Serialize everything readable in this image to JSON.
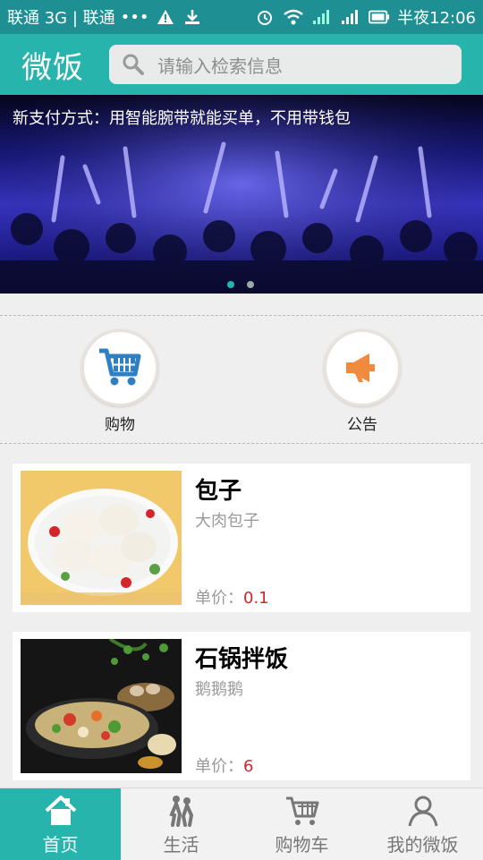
{
  "status_bar": {
    "carrier": "联通 3G | 联通",
    "dots": "•••",
    "time": "半夜12:06",
    "icons": [
      "warning-icon",
      "download-icon",
      "alarm-icon",
      "wifi-icon",
      "signal-icon",
      "signal-icon",
      "battery-icon"
    ]
  },
  "header": {
    "app_name": "微饭",
    "search_placeholder": "请输入检索信息"
  },
  "banner": {
    "caption": "新支付方式：用智能腕带就能买单，不用带钱包",
    "page_count": 2,
    "active_page": 1
  },
  "quick_actions": [
    {
      "label": "购物",
      "icon": "cart-icon",
      "accent": "#2f7fc1"
    },
    {
      "label": "公告",
      "icon": "megaphone-icon",
      "accent": "#f08a3e"
    }
  ],
  "products": [
    {
      "name": "包子",
      "description": "大肉包子",
      "price_label": "单价：",
      "price": "0.1"
    },
    {
      "name": "石锅拌饭",
      "description": "鹅鹅鹅",
      "price_label": "单价：",
      "price": "6"
    }
  ],
  "tabs": [
    {
      "label": "首页",
      "icon": "home-icon",
      "active": true
    },
    {
      "label": "生活",
      "icon": "people-icon",
      "active": false
    },
    {
      "label": "购物车",
      "icon": "cart-icon",
      "active": false
    },
    {
      "label": "我的微饭",
      "icon": "user-icon",
      "active": false
    }
  ],
  "colors": {
    "brand": "#27b4ad",
    "status_bar": "#1e8f93",
    "price": "#d0262b"
  }
}
